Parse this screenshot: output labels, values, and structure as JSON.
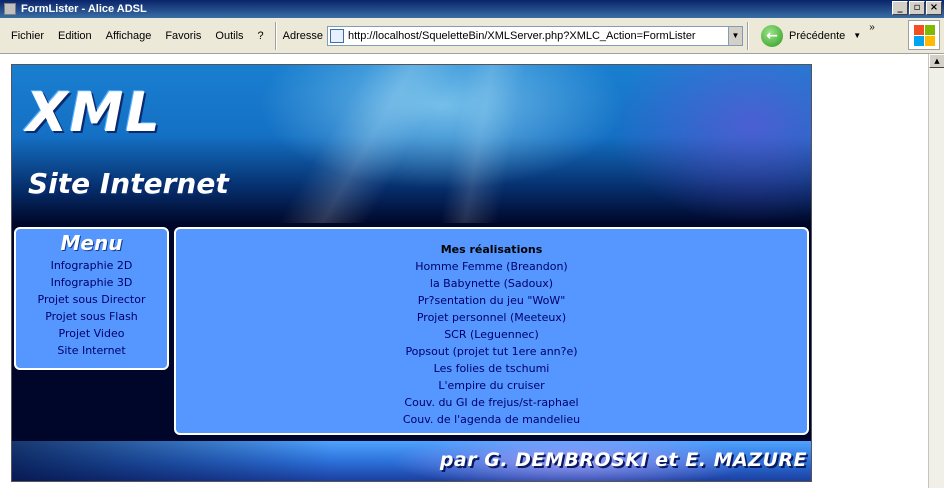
{
  "window": {
    "title": "FormLister - Alice ADSL"
  },
  "window_buttons": {
    "minimize": "_",
    "maximize": "▫",
    "close": "×"
  },
  "menubar": {
    "items": [
      "Fichier",
      "Edition",
      "Affichage",
      "Favoris",
      "Outils",
      "?"
    ]
  },
  "address": {
    "label": "Adresse",
    "url": "http://localhost/SqueletteBin/XMLServer.php?XMLC_Action=FormLister"
  },
  "nav": {
    "back_label": "Précédente"
  },
  "site": {
    "logo_title": "XML",
    "logo_subtitle": "Site Internet",
    "menu_title": "Menu",
    "menu_items": [
      "Infographie 2D",
      "Infographie 3D",
      "Projet sous Director",
      "Projet sous Flash",
      "Projet Video",
      "Site Internet"
    ],
    "content_title": "Mes réalisations",
    "projects": [
      "Homme Femme (Breandon)",
      "la Babynette (Sadoux)",
      "Pr?sentation du jeu \"WoW\"",
      "Projet personnel (Meeteux)",
      "SCR (Leguennec)",
      "Popsout (projet tut 1ere ann?e)",
      "Les folies de tschumi",
      "L'empire du cruiser",
      "Couv. du GI de frejus/st-raphael",
      "Couv. de l'agenda de mandelieu"
    ],
    "credits": "par G. DEMBROSKI et E. MAZURE"
  }
}
